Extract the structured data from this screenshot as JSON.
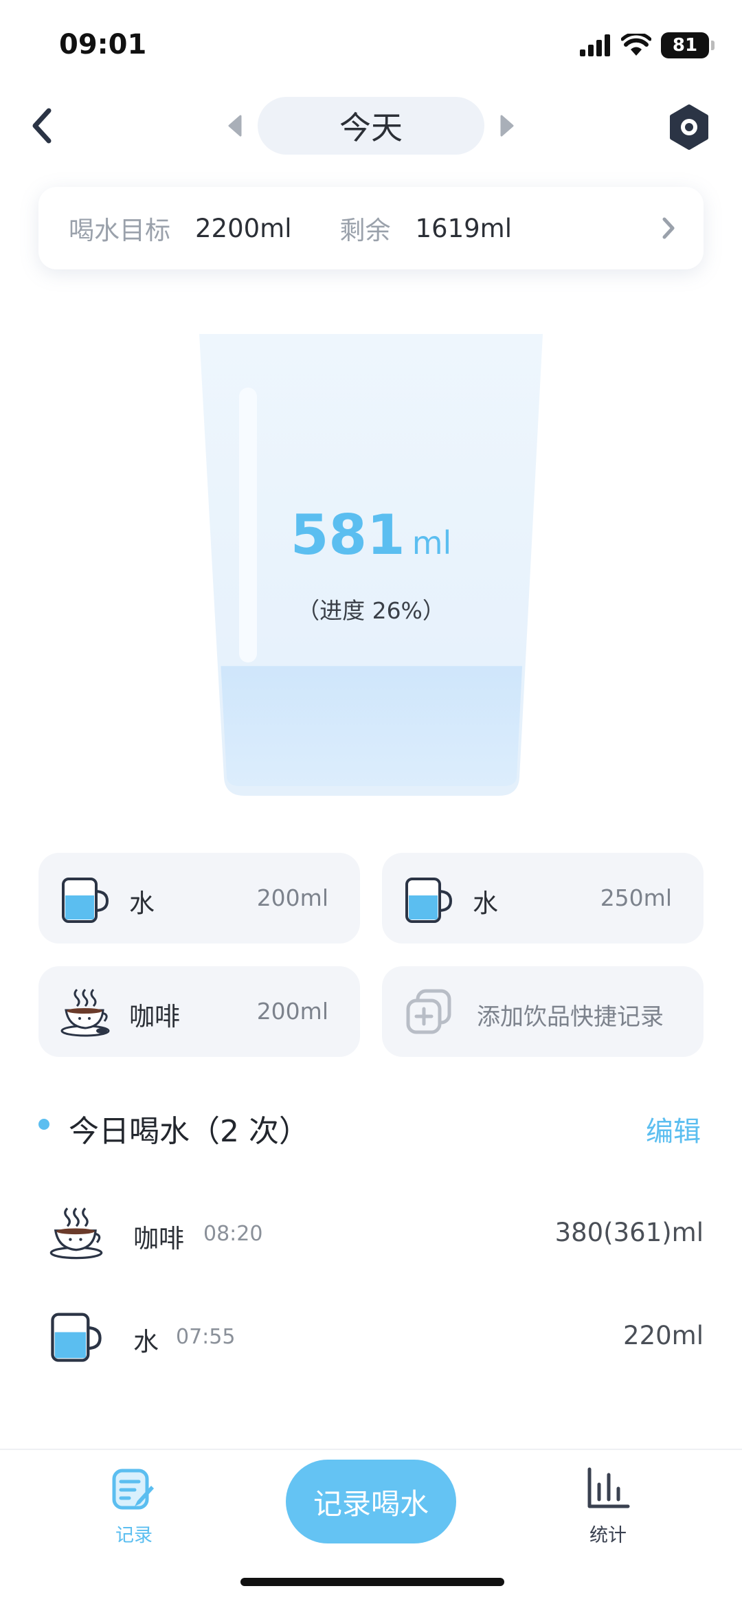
{
  "status_bar": {
    "time": "09:01",
    "battery": "81"
  },
  "header": {
    "date_label": "今天"
  },
  "goal": {
    "goal_label": "喝水目标",
    "goal_value": "2200ml",
    "remaining_label": "剩余",
    "remaining_value": "1619ml"
  },
  "cup": {
    "amount": "581",
    "unit": "ml",
    "progress_text": "（进度 26%）",
    "fill_fraction": 0.26
  },
  "quick_drinks": [
    {
      "name": "水",
      "amount": "200ml",
      "icon": "water-cup-icon"
    },
    {
      "name": "水",
      "amount": "250ml",
      "icon": "water-cup-icon"
    },
    {
      "name": "咖啡",
      "amount": "200ml",
      "icon": "coffee-cup-icon"
    }
  ],
  "add_drink_label": "添加饮品快捷记录",
  "history": {
    "title": "今日喝水（2 次）",
    "edit_label": "编辑",
    "entries": [
      {
        "name": "咖啡",
        "time": "08:20",
        "amount": "380(361)ml",
        "icon": "coffee-cup-icon"
      },
      {
        "name": "水",
        "time": "07:55",
        "amount": "220ml",
        "icon": "water-cup-icon"
      }
    ]
  },
  "bottom_nav": {
    "records_label": "记录",
    "record_button_label": "记录喝水",
    "stats_label": "统计"
  },
  "colors": {
    "accent": "#5bbef0",
    "tile_bg": "#f3f5f9",
    "water": "#5bbef0"
  }
}
